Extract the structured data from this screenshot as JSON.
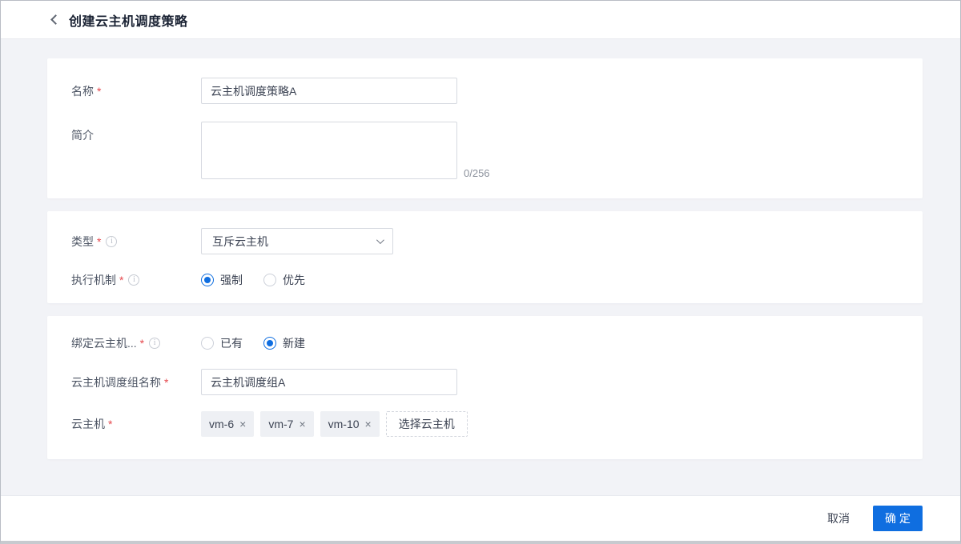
{
  "colors": {
    "accent": "#0f6ee0",
    "page_bg": "#f2f3f7",
    "required_red": "#e5484d"
  },
  "ui": {
    "required_mark": "*",
    "remove_icon": "×"
  },
  "header": {
    "title": "创建云主机调度策略"
  },
  "form": {
    "basic": {
      "name": {
        "label": "名称",
        "value": "云主机调度策略A"
      },
      "intro": {
        "label": "简介",
        "value": "",
        "counter": "0/256"
      }
    },
    "type_section": {
      "type": {
        "label": "类型",
        "value": "互斥云主机"
      },
      "mechanism": {
        "label": "执行机制",
        "options": [
          {
            "label": "强制",
            "selected": true
          },
          {
            "label": "优先",
            "selected": false
          }
        ]
      }
    },
    "bind_section": {
      "bind_group": {
        "label": "绑定云主机...",
        "options": [
          {
            "label": "已有",
            "selected": false
          },
          {
            "label": "新建",
            "selected": true
          }
        ]
      },
      "group_name": {
        "label": "云主机调度组名称",
        "value": "云主机调度组A"
      },
      "hosts": {
        "label": "云主机",
        "tags": [
          "vm-6",
          "vm-7",
          "vm-10"
        ],
        "select_button": "选择云主机"
      }
    }
  },
  "footer": {
    "cancel": "取消",
    "confirm": "确 定"
  }
}
